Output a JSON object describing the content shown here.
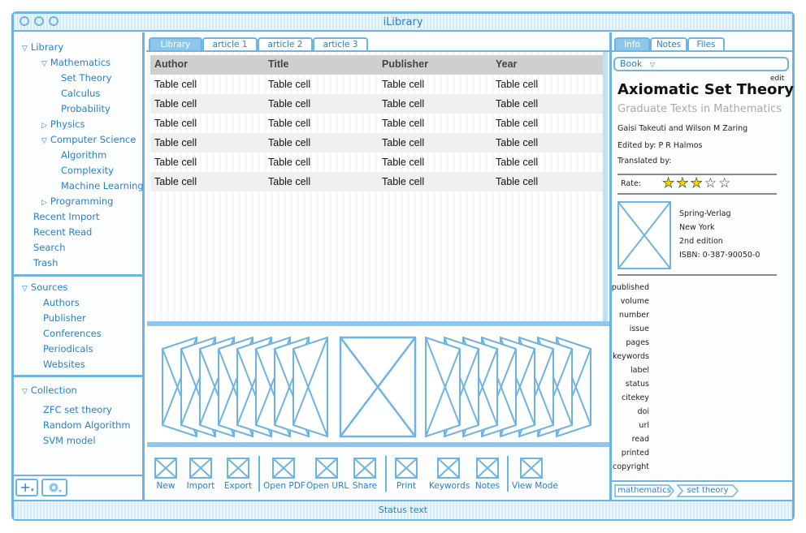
{
  "window": {
    "title": "iLibrary"
  },
  "statusbar": {
    "text": "Status text"
  },
  "sidebar": {
    "library": {
      "label": "Library",
      "mathematics": {
        "label": "Mathematics",
        "children": [
          "Set Theory",
          "Calculus",
          "Probability"
        ]
      },
      "physics": "Physics",
      "computer_science": {
        "label": "Computer Science",
        "children": [
          "Algorithm",
          "Complexity",
          "Machine Learning"
        ]
      },
      "programming": "Programming",
      "others": [
        "Recent Import",
        "Recent Read",
        "Search",
        "Trash"
      ]
    },
    "sources": {
      "label": "Sources",
      "children": [
        "Authors",
        "Publisher",
        "Conferences",
        "Periodicals",
        "Websites"
      ]
    },
    "collection": {
      "label": "Collection",
      "children": [
        "ZFC set theory",
        "Random Algorithm",
        "SVM model"
      ]
    }
  },
  "tabs": [
    "Library",
    "article 1",
    "article 2",
    "article 3"
  ],
  "table": {
    "columns": [
      "Author",
      "Title",
      "Publisher",
      "Year"
    ],
    "rows": [
      [
        "Table cell",
        "Table cell",
        "Table cell",
        "Table cell"
      ],
      [
        "Table cell",
        "Table cell",
        "Table cell",
        "Table cell"
      ],
      [
        "Table cell",
        "Table cell",
        "Table cell",
        "Table cell"
      ],
      [
        "Table cell",
        "Table cell",
        "Table cell",
        "Table cell"
      ],
      [
        "Table cell",
        "Table cell",
        "Table cell",
        "Table cell"
      ],
      [
        "Table cell",
        "Table cell",
        "Table cell",
        "Table cell"
      ]
    ]
  },
  "toolbar": [
    "New",
    "Import",
    "Export",
    "Open PDF",
    "Open URL",
    "Share",
    "Print",
    "Keywords",
    "Notes",
    "View Mode"
  ],
  "info": {
    "tabs": [
      "Info",
      "Notes",
      "Files"
    ],
    "type_select": "Book",
    "edit": "edit",
    "title": "Axiomatic Set Theory",
    "series": "Graduate Texts in Mathematics",
    "authors": "Gaisi Takeuti and Wilson M Zaring",
    "edited_by": "Edited by: P R Halmos",
    "translated_by": "Translated by:",
    "rate_label": "Rate:",
    "rating": 3,
    "rating_max": 5,
    "publisher_lines": [
      "Spring-Verlag",
      "New York",
      "2nd edition",
      "ISBN: 0-387-90050-0"
    ],
    "fields": [
      "published",
      "volume",
      "number",
      "issue",
      "pages",
      "keywords",
      "label",
      "status",
      "citekey",
      "doi",
      "url",
      "read",
      "printed",
      "copyright"
    ],
    "tags": [
      "mathematics",
      "set theory"
    ]
  },
  "colors": {
    "accent": "#6fb3e2",
    "accent_fill": "#8ec7ec",
    "text": "#2a7fc9",
    "star": "#f2d600"
  }
}
